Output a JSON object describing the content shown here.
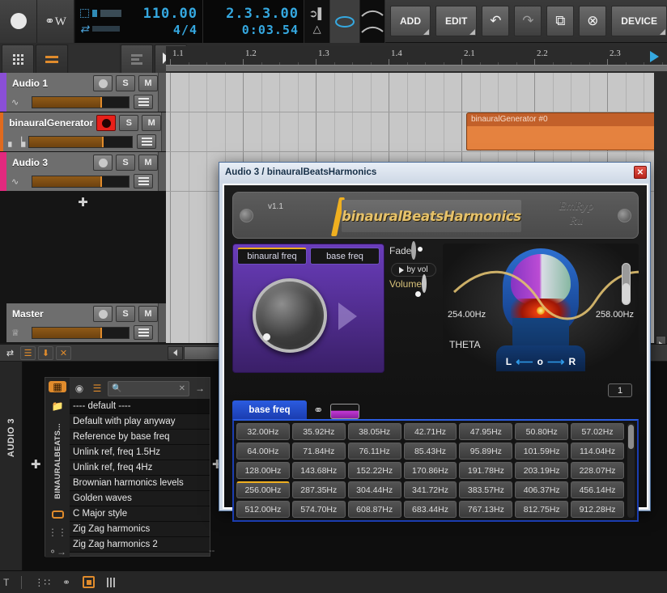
{
  "transport": {
    "record_label": "record",
    "automation_label": "W",
    "tempo": "110.00",
    "time_signature": "4/4",
    "position": "2.3.3.00",
    "elapsed": "0:03.54",
    "buttons": [
      {
        "label": "ADD",
        "name": "add-button"
      },
      {
        "label": "EDIT",
        "name": "edit-button"
      },
      {
        "label": "↶",
        "name": "undo-button"
      },
      {
        "label": "↷",
        "name": "redo-button"
      },
      {
        "label": "⧉",
        "name": "duplicate-button"
      },
      {
        "label": "⊗",
        "name": "delete-button"
      },
      {
        "label": "DEVICE",
        "name": "device-button"
      }
    ]
  },
  "ruler": {
    "ticks": [
      "1.1",
      "1.2",
      "1.3",
      "1.4",
      "2.1",
      "2.2",
      "2.3"
    ]
  },
  "arrangement": {
    "clip_name": "binauralGenerator #0"
  },
  "tracks": [
    {
      "name": "Audio 1",
      "color": "#8a4fd6",
      "armed": false,
      "solo": "S",
      "mute": "M",
      "type_icon": "waveform-icon"
    },
    {
      "name": "binauralGenerator",
      "color": "#e06a1e",
      "armed": true,
      "solo": "S",
      "mute": "M",
      "type_icon": "midi-icon"
    },
    {
      "name": "Audio 3",
      "color": "#e2297e",
      "armed": false,
      "solo": "S",
      "mute": "M",
      "type_icon": "waveform-icon"
    }
  ],
  "master_track": {
    "name": "Master",
    "solo": "S",
    "mute": "M",
    "type_icon": "crown-icon"
  },
  "device_panel": {
    "track_label": "AUDIO 3",
    "device_label": "BINAURALBEATS...",
    "search_placeholder": "",
    "presets": [
      "---- default ----",
      "Default with play anyway",
      "Reference by base freq",
      "Unlink ref, freq 1.5Hz",
      "Unlink ref, freq 4Hz",
      "Brownian harmonics levels",
      "Golden waves",
      "C Major style",
      "Zig Zag harmonics",
      "Zig Zag harmonics 2"
    ],
    "dashes": "--"
  },
  "plugin": {
    "window_title": "Audio 3 / binauralBeatsHarmonics",
    "close_label": "✕",
    "version": "v1.1",
    "name": "binauralBeatsHarmonics",
    "brand_line1": "EmRyp",
    "brand_line2": "Ru",
    "tabs": [
      {
        "label": "binaural freq",
        "selected": true
      },
      {
        "label": "base freq",
        "selected": false
      }
    ],
    "fade_label": "Fade",
    "by_vol_label": "by vol",
    "volume_label": "Volume",
    "left_freq": "254.00Hz",
    "right_freq": "258.00Hz",
    "brain_state": "THETA",
    "pan_left": "L",
    "pan_center": "o",
    "pan_right": "R",
    "voice_count": "1",
    "grid_tab_label": "base freq",
    "link_icon": "link-icon",
    "wave_icon": "waveform-thumb-icon",
    "frequencies": [
      [
        "32.00Hz",
        "35.92Hz",
        "38.05Hz",
        "42.71Hz",
        "47.95Hz",
        "50.80Hz",
        "57.02Hz"
      ],
      [
        "64.00Hz",
        "71.84Hz",
        "76.11Hz",
        "85.43Hz",
        "95.89Hz",
        "101.59Hz",
        "114.04Hz"
      ],
      [
        "128.00Hz",
        "143.68Hz",
        "152.22Hz",
        "170.86Hz",
        "191.78Hz",
        "203.19Hz",
        "228.07Hz"
      ],
      [
        "256.00Hz",
        "287.35Hz",
        "304.44Hz",
        "341.72Hz",
        "383.57Hz",
        "406.37Hz",
        "456.14Hz"
      ],
      [
        "512.00Hz",
        "574.70Hz",
        "608.87Hz",
        "683.44Hz",
        "767.13Hz",
        "812.75Hz",
        "912.28Hz"
      ]
    ],
    "selected_frequency": "256.00Hz"
  },
  "colors": {
    "accent_orange": "#e08b2c",
    "accent_blue": "#2b5ce0",
    "record_red": "#e8201a",
    "clip_orange": "#e5823f",
    "knob_purple": "#6a3dbb"
  }
}
